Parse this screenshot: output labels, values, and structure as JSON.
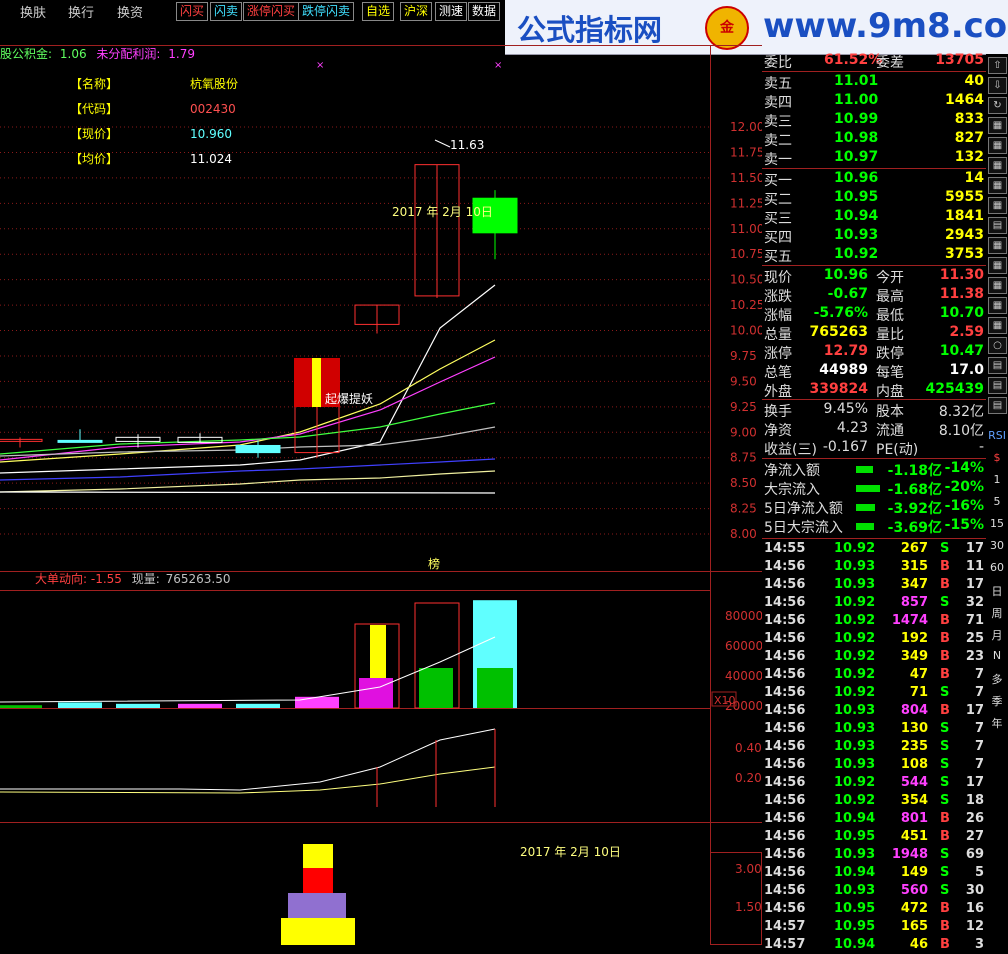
{
  "toolbar": {
    "menus": [
      "换肤",
      "换行",
      "换资"
    ],
    "buttons": [
      {
        "label": "闪买",
        "color": "#ff4040"
      },
      {
        "label": "闪卖",
        "color": "#40e0ff"
      },
      {
        "label": "涨停闪买",
        "color": "#ff4040"
      },
      {
        "label": "跌停闪卖",
        "color": "#40e0ff"
      },
      {
        "label": "自选",
        "color": "#ffff00"
      },
      {
        "label": "沪深",
        "color": "#ffff00"
      },
      {
        "label": "测速",
        "color": "#ffffff"
      },
      {
        "label": "数据",
        "color": "#ffffff"
      }
    ]
  },
  "logo": {
    "brand": "公式指标网",
    "circle": "金",
    "url": "www.9m8.com"
  },
  "main_chart": {
    "header": {
      "prefix": "股公积金:",
      "prefix_value": "1.06",
      "undist_label": "未分配利润:",
      "undist_value": "1.79"
    },
    "info": [
      {
        "label": "【名称】",
        "value": "杭氧股份",
        "color": "#ffff00"
      },
      {
        "label": "【代码】",
        "value": "002430",
        "color": "#ff5050"
      },
      {
        "label": "【现价】",
        "value": "10.960",
        "color": "#60ffff"
      },
      {
        "label": "【均价】",
        "value": "11.024",
        "color": "#ffffff"
      }
    ],
    "high_label": "11.63",
    "date_label": "2017 年 2月 10日",
    "signal_label": "起爆提妖",
    "bottom_tag": "榜",
    "price_axis": [
      "12.00",
      "11.75",
      "11.50",
      "11.25",
      "11.00",
      "10.75",
      "10.50",
      "10.25",
      "10.00",
      "9.75",
      "9.50",
      "9.25",
      "9.00",
      "8.75",
      "8.50",
      "8.25",
      "8.00"
    ]
  },
  "volume_panel": {
    "title": "大单动向: -1.55",
    "vol_label": "现量:",
    "vol_value": "765263.50",
    "axis": [
      "80000",
      "60000",
      "40000",
      "20000"
    ],
    "unit": "X10"
  },
  "indicator_panel": {
    "axis": [
      "0.40",
      "0.20"
    ]
  },
  "bottom_panel": {
    "date_label": "2017 年 2月 10日",
    "axis": [
      "3.00",
      "1.50"
    ]
  },
  "order_book": {
    "top": [
      {
        "label": "委比",
        "value": "61.52%",
        "label2": "委差",
        "value2": "13705"
      }
    ],
    "asks": [
      {
        "label": "卖五",
        "price": "11.01",
        "qty": "40"
      },
      {
        "label": "卖四",
        "price": "11.00",
        "qty": "1464"
      },
      {
        "label": "卖三",
        "price": "10.99",
        "qty": "833"
      },
      {
        "label": "卖二",
        "price": "10.98",
        "qty": "827"
      },
      {
        "label": "卖一",
        "price": "10.97",
        "qty": "132"
      }
    ],
    "bids": [
      {
        "label": "买一",
        "price": "10.96",
        "qty": "14"
      },
      {
        "label": "买二",
        "price": "10.95",
        "qty": "5955"
      },
      {
        "label": "买三",
        "price": "10.94",
        "qty": "1841"
      },
      {
        "label": "买四",
        "price": "10.93",
        "qty": "2943"
      },
      {
        "label": "买五",
        "price": "10.92",
        "qty": "3753"
      }
    ]
  },
  "quote": [
    {
      "l1": "现价",
      "v1": "10.96",
      "c1": "#00ff00",
      "l2": "今开",
      "v2": "11.30",
      "c2": "#ff4040"
    },
    {
      "l1": "涨跌",
      "v1": "-0.67",
      "c1": "#00ff00",
      "l2": "最高",
      "v2": "11.38",
      "c2": "#ff4040"
    },
    {
      "l1": "涨幅",
      "v1": "-5.76%",
      "c1": "#00ff00",
      "l2": "最低",
      "v2": "10.70",
      "c2": "#00ff00"
    },
    {
      "l1": "总量",
      "v1": "765263",
      "c1": "#ffff00",
      "l2": "量比",
      "v2": "2.59",
      "c2": "#ff4040"
    },
    {
      "l1": "涨停",
      "v1": "12.79",
      "c1": "#ff4040",
      "l2": "跌停",
      "v2": "10.47",
      "c2": "#00ff00"
    },
    {
      "l1": "总笔",
      "v1": "44989",
      "c1": "#ffffff",
      "l2": "每笔",
      "v2": "17.0",
      "c2": "#ffffff"
    },
    {
      "l1": "外盘",
      "v1": "339824",
      "c1": "#ff4040",
      "l2": "内盘",
      "v2": "425439",
      "c2": "#00ff00"
    }
  ],
  "finance": [
    {
      "l1": "换手",
      "v1": "9.45%",
      "l2": "股本",
      "v2": "8.32亿"
    },
    {
      "l1": "净资",
      "v1": "4.23",
      "l2": "流通",
      "v2": "8.10亿"
    },
    {
      "l1": "收益(三)",
      "v1": "-0.167",
      "l2": "PE(动)",
      "v2": "-"
    }
  ],
  "flows": [
    {
      "label": "净流入额",
      "value": "-1.18亿",
      "pct": "-14%",
      "bar": 0.14
    },
    {
      "label": "大宗流入",
      "value": "-1.68亿",
      "pct": "-20%",
      "bar": 0.2
    },
    {
      "label": "5日净流入额",
      "value": "-3.92亿",
      "pct": "-16%",
      "bar": 0.16
    },
    {
      "label": "5日大宗流入",
      "value": "-3.69亿",
      "pct": "-15%",
      "bar": 0.15
    }
  ],
  "ticks": [
    {
      "time": "14:55",
      "price": "10.92",
      "vol": "267",
      "side": "S",
      "n": "17",
      "pc": "#00ff00",
      "vc": "#ffff00"
    },
    {
      "time": "14:56",
      "price": "10.93",
      "vol": "315",
      "side": "B",
      "n": "11",
      "pc": "#00ff00",
      "vc": "#ffff00"
    },
    {
      "time": "14:56",
      "price": "10.93",
      "vol": "347",
      "side": "B",
      "n": "17",
      "pc": "#00ff00",
      "vc": "#ffff00"
    },
    {
      "time": "14:56",
      "price": "10.92",
      "vol": "857",
      "side": "S",
      "n": "32",
      "pc": "#00ff00",
      "vc": "#ff40ff"
    },
    {
      "time": "14:56",
      "price": "10.92",
      "vol": "1474",
      "side": "B",
      "n": "71",
      "pc": "#00ff00",
      "vc": "#ff40ff"
    },
    {
      "time": "14:56",
      "price": "10.92",
      "vol": "192",
      "side": "B",
      "n": "25",
      "pc": "#00ff00",
      "vc": "#ffff00"
    },
    {
      "time": "14:56",
      "price": "10.92",
      "vol": "349",
      "side": "B",
      "n": "23",
      "pc": "#00ff00",
      "vc": "#ffff00"
    },
    {
      "time": "14:56",
      "price": "10.92",
      "vol": "47",
      "side": "B",
      "n": "7",
      "pc": "#00ff00",
      "vc": "#ffff00"
    },
    {
      "time": "14:56",
      "price": "10.92",
      "vol": "71",
      "side": "S",
      "n": "7",
      "pc": "#00ff00",
      "vc": "#ffff00"
    },
    {
      "time": "14:56",
      "price": "10.93",
      "vol": "804",
      "side": "B",
      "n": "17",
      "pc": "#00ff00",
      "vc": "#ff40ff"
    },
    {
      "time": "14:56",
      "price": "10.93",
      "vol": "130",
      "side": "S",
      "n": "7",
      "pc": "#00ff00",
      "vc": "#ffff00"
    },
    {
      "time": "14:56",
      "price": "10.93",
      "vol": "235",
      "side": "S",
      "n": "7",
      "pc": "#00ff00",
      "vc": "#ffff00"
    },
    {
      "time": "14:56",
      "price": "10.93",
      "vol": "108",
      "side": "S",
      "n": "7",
      "pc": "#00ff00",
      "vc": "#ffff00"
    },
    {
      "time": "14:56",
      "price": "10.92",
      "vol": "544",
      "side": "S",
      "n": "17",
      "pc": "#00ff00",
      "vc": "#ff40ff"
    },
    {
      "time": "14:56",
      "price": "10.92",
      "vol": "354",
      "side": "S",
      "n": "18",
      "pc": "#00ff00",
      "vc": "#ffff00"
    },
    {
      "time": "14:56",
      "price": "10.94",
      "vol": "801",
      "side": "B",
      "n": "26",
      "pc": "#00ff00",
      "vc": "#ff40ff"
    },
    {
      "time": "14:56",
      "price": "10.95",
      "vol": "451",
      "side": "B",
      "n": "27",
      "pc": "#00ff00",
      "vc": "#ffff00"
    },
    {
      "time": "14:56",
      "price": "10.93",
      "vol": "1948",
      "side": "S",
      "n": "69",
      "pc": "#00ff00",
      "vc": "#ff40ff"
    },
    {
      "time": "14:56",
      "price": "10.94",
      "vol": "149",
      "side": "S",
      "n": "5",
      "pc": "#00ff00",
      "vc": "#ffff00"
    },
    {
      "time": "14:56",
      "price": "10.93",
      "vol": "560",
      "side": "S",
      "n": "30",
      "pc": "#00ff00",
      "vc": "#ff40ff"
    },
    {
      "time": "14:56",
      "price": "10.95",
      "vol": "472",
      "side": "B",
      "n": "16",
      "pc": "#00ff00",
      "vc": "#ffff00"
    },
    {
      "time": "14:57",
      "price": "10.95",
      "vol": "165",
      "side": "B",
      "n": "12",
      "pc": "#00ff00",
      "vc": "#ffff00"
    },
    {
      "time": "14:57",
      "price": "10.94",
      "vol": "46",
      "side": "B",
      "n": "3",
      "pc": "#00ff00",
      "vc": "#ffff00"
    }
  ],
  "side_icons": [
    "up-arrow-icon",
    "down-arrow-icon",
    "refresh-icon",
    "grid-icon",
    "grid-icon",
    "grid-icon",
    "grid-icon",
    "grid-icon",
    "chart-icon",
    "grid-icon",
    "grid-icon",
    "grid-icon",
    "grid-icon",
    "grid-icon",
    "circle-icon",
    "chart-icon",
    "chart-icon",
    "chart-icon"
  ],
  "side_labels": [
    "RSI",
    "$",
    "1",
    "5",
    "15",
    "30",
    "60",
    "日",
    "周",
    "月",
    "N",
    "多",
    "季",
    "年"
  ],
  "chart_data": {
    "type": "candlestick",
    "candles": [
      {
        "o": 8.93,
        "h": 8.95,
        "l": 8.85,
        "c": 8.93,
        "color": "#ff3030"
      },
      {
        "o": 8.92,
        "h": 9.03,
        "l": 8.9,
        "c": 8.92,
        "color": "#60ffff"
      },
      {
        "o": 8.95,
        "h": 8.98,
        "l": 8.85,
        "c": 8.91,
        "color": "#ffffff"
      },
      {
        "o": 8.95,
        "h": 8.99,
        "l": 8.9,
        "c": 8.9,
        "color": "#ffffff"
      },
      {
        "o": 8.87,
        "h": 8.92,
        "l": 8.75,
        "c": 8.8,
        "color": "#60ffff"
      },
      {
        "o": 8.8,
        "h": 9.67,
        "l": 8.75,
        "c": 9.67,
        "color": "#ff3030"
      },
      {
        "o": 10.25,
        "h": 10.25,
        "l": 9.97,
        "c": 10.06,
        "color": "#ff3030"
      },
      {
        "o": 10.34,
        "h": 11.63,
        "l": 10.32,
        "c": 11.63,
        "color": "#ff3030"
      },
      {
        "o": 11.3,
        "h": 11.38,
        "l": 10.7,
        "c": 10.96,
        "color": "#00ff00"
      }
    ],
    "volume": [
      2000,
      4000,
      3000,
      3000,
      3000,
      8000,
      60000,
      75000,
      77000
    ],
    "ylim": [
      8.0,
      12.0
    ]
  }
}
